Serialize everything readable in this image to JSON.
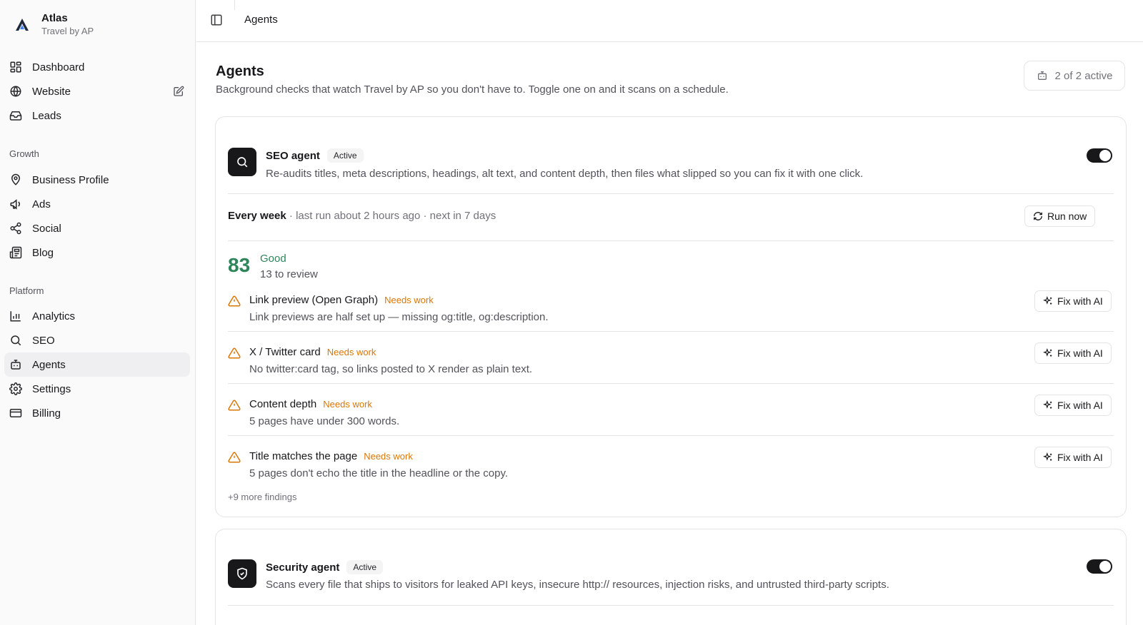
{
  "brand": {
    "name": "Atlas",
    "subtitle": "Travel by AP"
  },
  "sidebar": {
    "primary": [
      {
        "label": "Dashboard",
        "icon": "dashboard-icon"
      },
      {
        "label": "Website",
        "icon": "globe-icon"
      },
      {
        "label": "Leads",
        "icon": "inbox-icon"
      }
    ],
    "growth_label": "Growth",
    "growth": [
      {
        "label": "Business Profile",
        "icon": "map-pin-icon"
      },
      {
        "label": "Ads",
        "icon": "megaphone-icon"
      },
      {
        "label": "Social",
        "icon": "share-icon"
      },
      {
        "label": "Blog",
        "icon": "newspaper-icon"
      }
    ],
    "platform_label": "Platform",
    "platform": [
      {
        "label": "Analytics",
        "icon": "bar-chart-icon"
      },
      {
        "label": "SEO",
        "icon": "search-icon"
      },
      {
        "label": "Agents",
        "icon": "bot-icon",
        "active": true
      },
      {
        "label": "Settings",
        "icon": "gear-icon"
      },
      {
        "label": "Billing",
        "icon": "credit-card-icon"
      }
    ]
  },
  "topbar": {
    "breadcrumb": "Agents"
  },
  "page": {
    "title": "Agents",
    "subtitle": "Background checks that watch Travel by AP so you don't have to. Toggle one on and it scans on a schedule.",
    "active_count": "2 of 2 active"
  },
  "agents": [
    {
      "name": "SEO agent",
      "status": "Active",
      "description": "Re-audits titles, meta descriptions, headings, alt text, and content depth, then files what slipped so you can fix it with one click.",
      "enabled": true,
      "schedule": "Every week",
      "schedule_detail": " · last run about 2 hours ago · next in 7 days",
      "run_label": "Run now",
      "score": "83",
      "score_label": "Good",
      "review_count": "13 to review",
      "findings": [
        {
          "title": "Link preview (Open Graph)",
          "tag": "Needs work",
          "description": "Link previews are half set up — missing og:title, og:description.",
          "action": "Fix with AI"
        },
        {
          "title": "X / Twitter card",
          "tag": "Needs work",
          "description": "No twitter:card tag, so links posted to X render as plain text.",
          "action": "Fix with AI"
        },
        {
          "title": "Content depth",
          "tag": "Needs work",
          "description": "5 pages have under 300 words.",
          "action": "Fix with AI"
        },
        {
          "title": "Title matches the page",
          "tag": "Needs work",
          "description": "5 pages don't echo the title in the headline or the copy.",
          "action": "Fix with AI"
        }
      ],
      "more_findings": "+9 more findings"
    },
    {
      "name": "Security agent",
      "status": "Active",
      "description": "Scans every file that ships to visitors for leaked API keys, insecure http:// resources, injection risks, and untrusted third-party scripts.",
      "enabled": true
    }
  ],
  "colors": {
    "accent_good": "#2f855a",
    "warning": "#d97706",
    "primary": "#18181b"
  }
}
